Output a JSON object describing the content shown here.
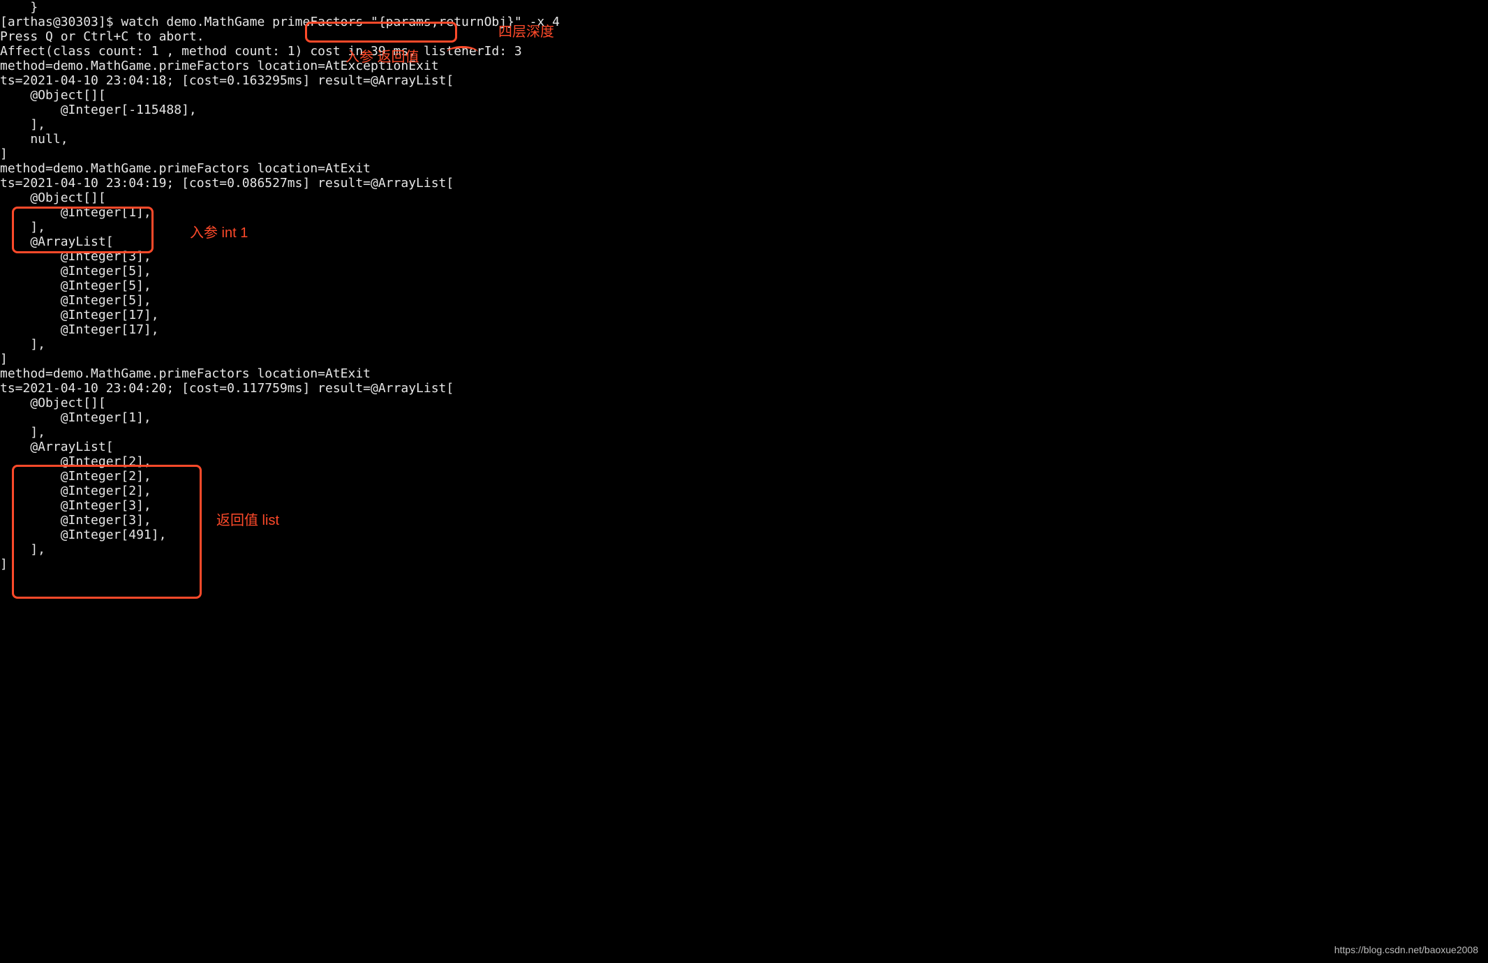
{
  "terminal": {
    "lines": [
      "    }",
      "",
      "[arthas@30303]$ watch demo.MathGame primeFactors \"{params,returnObj}\" -x 4",
      "Press Q or Ctrl+C to abort.",
      "Affect(class count: 1 , method count: 1) cost in 39 ms, listenerId: 3",
      "method=demo.MathGame.primeFactors location=AtExceptionExit",
      "ts=2021-04-10 23:04:18; [cost=0.163295ms] result=@ArrayList[",
      "    @Object[][",
      "        @Integer[-115488],",
      "    ],",
      "    null,",
      "]",
      "method=demo.MathGame.primeFactors location=AtExit",
      "ts=2021-04-10 23:04:19; [cost=0.086527ms] result=@ArrayList[",
      "    @Object[][",
      "        @Integer[1],",
      "    ],",
      "    @ArrayList[",
      "        @Integer[3],",
      "        @Integer[5],",
      "        @Integer[5],",
      "        @Integer[5],",
      "        @Integer[17],",
      "        @Integer[17],",
      "    ],",
      "]",
      "method=demo.MathGame.primeFactors location=AtExit",
      "ts=2021-04-10 23:04:20; [cost=0.117759ms] result=@ArrayList[",
      "    @Object[][",
      "        @Integer[1],",
      "    ],",
      "    @ArrayList[",
      "        @Integer[2],",
      "        @Integer[2],",
      "        @Integer[2],",
      "        @Integer[3],",
      "        @Integer[3],",
      "        @Integer[491],",
      "    ],",
      "]"
    ]
  },
  "annotations": {
    "label_depth": "四层深度",
    "label_params_return": "入参 返回值",
    "label_param_int1": "入参 int 1",
    "label_return_list": "返回值 list"
  },
  "watermark": "https://blog.csdn.net/baoxue2008"
}
